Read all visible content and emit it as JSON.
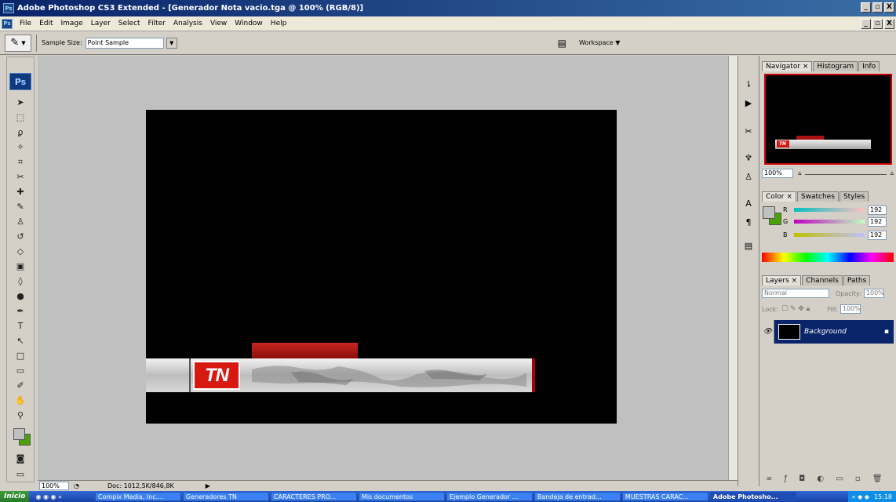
{
  "window": {
    "title": "Adobe Photoshop CS3 Extended - [Generador Nota vacio.tga @ 100% (RGB/8)]",
    "app_icon": "Ps",
    "min_label": "_",
    "max_label": "̅̅",
    "close_label": "X"
  },
  "menu": {
    "items": [
      "File",
      "Edit",
      "Image",
      "Layer",
      "Select",
      "Filter",
      "Analysis",
      "View",
      "Window",
      "Help"
    ]
  },
  "options": {
    "sample_size_label": "Sample Size:",
    "sample_size_value": "Point Sample",
    "workspace_label": "Workspace ▼"
  },
  "toolbox": {
    "logo": "Ps",
    "tools": [
      "move-tool-icon",
      "marquee-tool-icon",
      "lasso-tool-icon",
      "magic-wand-tool-icon",
      "crop-tool-icon",
      "slice-tool-icon",
      "healing-brush-icon",
      "brush-tool-icon",
      "clone-stamp-icon",
      "history-brush-icon",
      "eraser-tool-icon",
      "gradient-tool-icon",
      "blur-tool-icon",
      "dodge-tool-icon",
      "pen-tool-icon",
      "type-tool-icon",
      "path-selection-icon",
      "shape-tool-icon",
      "notes-tool-icon",
      "eyedropper-tool-icon",
      "hand-tool-icon",
      "zoom-tool-icon"
    ],
    "fg_color": "#c0c0c0",
    "bg_color": "#4ca10a"
  },
  "canvas": {
    "logo_text": "TN"
  },
  "status": {
    "zoom": "100%",
    "doc": "Doc: 1012,5K/846,8K"
  },
  "panels": {
    "navigator_tabs": [
      "Navigator ×",
      "Histogram",
      "Info"
    ],
    "nav_zoom": "100%",
    "color_tabs": [
      "Color ×",
      "Swatches",
      "Styles"
    ],
    "color_channels": [
      {
        "label": "R",
        "value": "192"
      },
      {
        "label": "G",
        "value": "192"
      },
      {
        "label": "B",
        "value": "192"
      }
    ],
    "layers_tabs": [
      "Layers ×",
      "Channels",
      "Paths"
    ],
    "blend_mode": "Normal",
    "opacity_label": "Opacity:",
    "opacity_value": "100%",
    "lock_label": "Lock:",
    "fill_label": "Fill:",
    "fill_value": "100%",
    "layer_name": "Background"
  },
  "taskbar": {
    "start": "Inicio",
    "tasks": [
      "Compix Media, Inc....",
      "Generadores TN",
      "CARACTERES PRO...",
      "Mis documentos",
      "Ejemplo Generador ...",
      "Bandeja de entrad...",
      "MUESTRAS CARAC...",
      "Adobe Photosho..."
    ],
    "clock": "15:18"
  }
}
